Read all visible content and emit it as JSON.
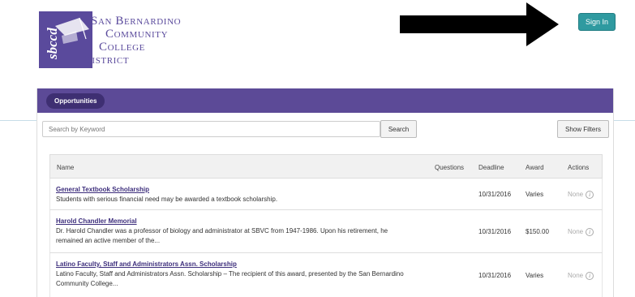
{
  "logo": {
    "emblem_text": "sbccd",
    "line1": "San Bernardino",
    "line2": "Community",
    "line3": "College",
    "line4": "District"
  },
  "header": {
    "signin_label": "Sign In"
  },
  "panel": {
    "tab_label": "Opportunities"
  },
  "search": {
    "placeholder": "Search by Keyword",
    "button_label": "Search",
    "filters_label": "Show Filters"
  },
  "table": {
    "headers": {
      "name": "Name",
      "questions": "Questions",
      "deadline": "Deadline",
      "award": "Award",
      "actions": "Actions"
    },
    "rows": [
      {
        "title": "General Textbook Scholarship",
        "description": "Students with serious financial need may be awarded a textbook scholarship.",
        "deadline": "10/31/2016",
        "award": "Varies",
        "actions": "None"
      },
      {
        "title": "Harold Chandler Memorial",
        "description": "Dr. Harold Chandler was a professor of biology and administrator at SBVC from 1947-1986. Upon his retirement, he remained an active member of the...",
        "deadline": "10/31/2016",
        "award": "$150.00",
        "actions": "None"
      },
      {
        "title": "Latino Faculty, Staff and Administrators Assn. Scholarship",
        "description": "Latino Faculty, Staff and Administrators Assn. Scholarship – The recipient of this award, presented by the San Bernardino Community College...",
        "deadline": "10/31/2016",
        "award": "Varies",
        "actions": "None"
      }
    ]
  },
  "colors": {
    "brand_purple": "#5c4a97",
    "pill_dark": "#3e2f72",
    "signin_teal": "#2f9aa0",
    "link": "#3d2e7c"
  }
}
